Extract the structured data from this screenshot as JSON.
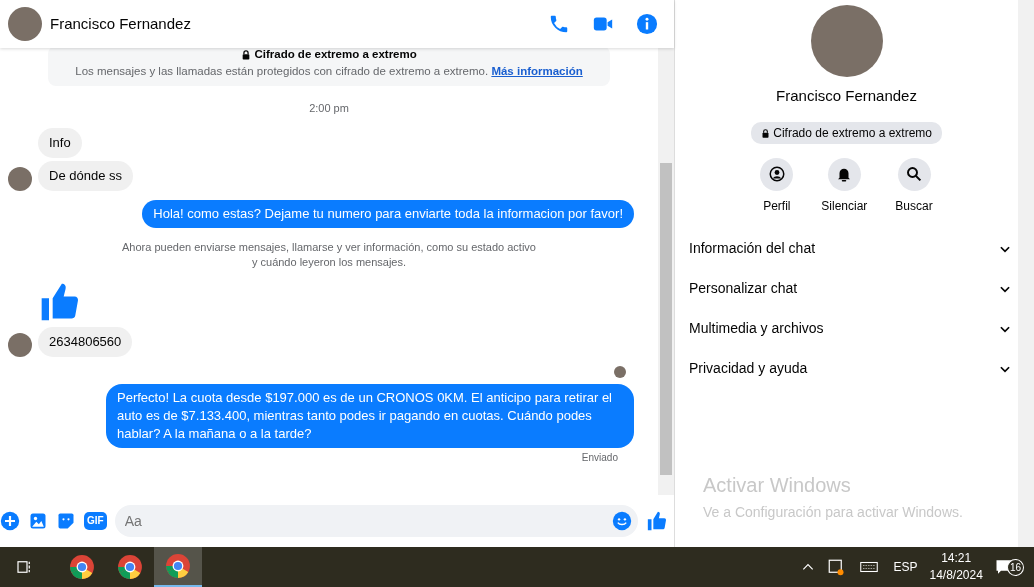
{
  "chat": {
    "header": {
      "name": "Francisco Fernandez"
    },
    "encryption_notice": {
      "title": "Cifrado de extremo a extremo",
      "text": "Los mensajes y las llamadas están protegidos con cifrado de extremo a extremo.",
      "link": "Más información"
    },
    "messages": [
      {
        "kind": "time",
        "text": "2:00 pm"
      },
      {
        "kind": "incoming",
        "text": "Info",
        "avatar": false
      },
      {
        "kind": "incoming",
        "text": "De dónde ss",
        "avatar": true
      },
      {
        "kind": "outgoing",
        "text": "Hola! como estas? Dejame tu numero para enviarte toda la informacion por favor!"
      },
      {
        "kind": "system",
        "lines": [
          "Ahora pueden enviarse mensajes, llamarse y ver información, como su estado activo",
          "y cuándo leyeron los mensajes."
        ]
      },
      {
        "kind": "like",
        "avatar": false
      },
      {
        "kind": "incoming",
        "text": "2634806560",
        "avatar": true
      },
      {
        "kind": "seen"
      },
      {
        "kind": "outgoing",
        "text": "Perfecto! La cuota desde $197.000 es de un CRONOS 0KM. El anticipo para retirar el auto es de $7.133.400, mientras tanto podes ir pagando en cuotas. Cuándo podes hablar? A la mañana o a la tarde?"
      },
      {
        "kind": "status",
        "text": "Enviado"
      }
    ],
    "composer": {
      "gif_label": "GIF",
      "placeholder": "Aa"
    }
  },
  "details": {
    "name": "Francisco Fernandez",
    "encryption_badge": "Cifrado de extremo a extremo",
    "actions": [
      {
        "kind": "profile",
        "label": "Perfil"
      },
      {
        "kind": "mute",
        "label": "Silenciar"
      },
      {
        "kind": "search",
        "label": "Buscar"
      }
    ],
    "sections": [
      {
        "label": "Información del chat"
      },
      {
        "label": "Personalizar chat"
      },
      {
        "label": "Multimedia y archivos"
      },
      {
        "label": "Privacidad y ayuda"
      }
    ]
  },
  "activation": {
    "title": "Activar Windows",
    "text": "Ve a Configuración para activar Windows."
  },
  "taskbar": {
    "apps": [
      {
        "kind": "chrome",
        "selected": false
      },
      {
        "kind": "chrome",
        "selected": false
      },
      {
        "kind": "chrome",
        "selected": true
      }
    ],
    "language": "ESP",
    "time": "14:21",
    "date": "14/8/2024",
    "notifications": "16"
  }
}
